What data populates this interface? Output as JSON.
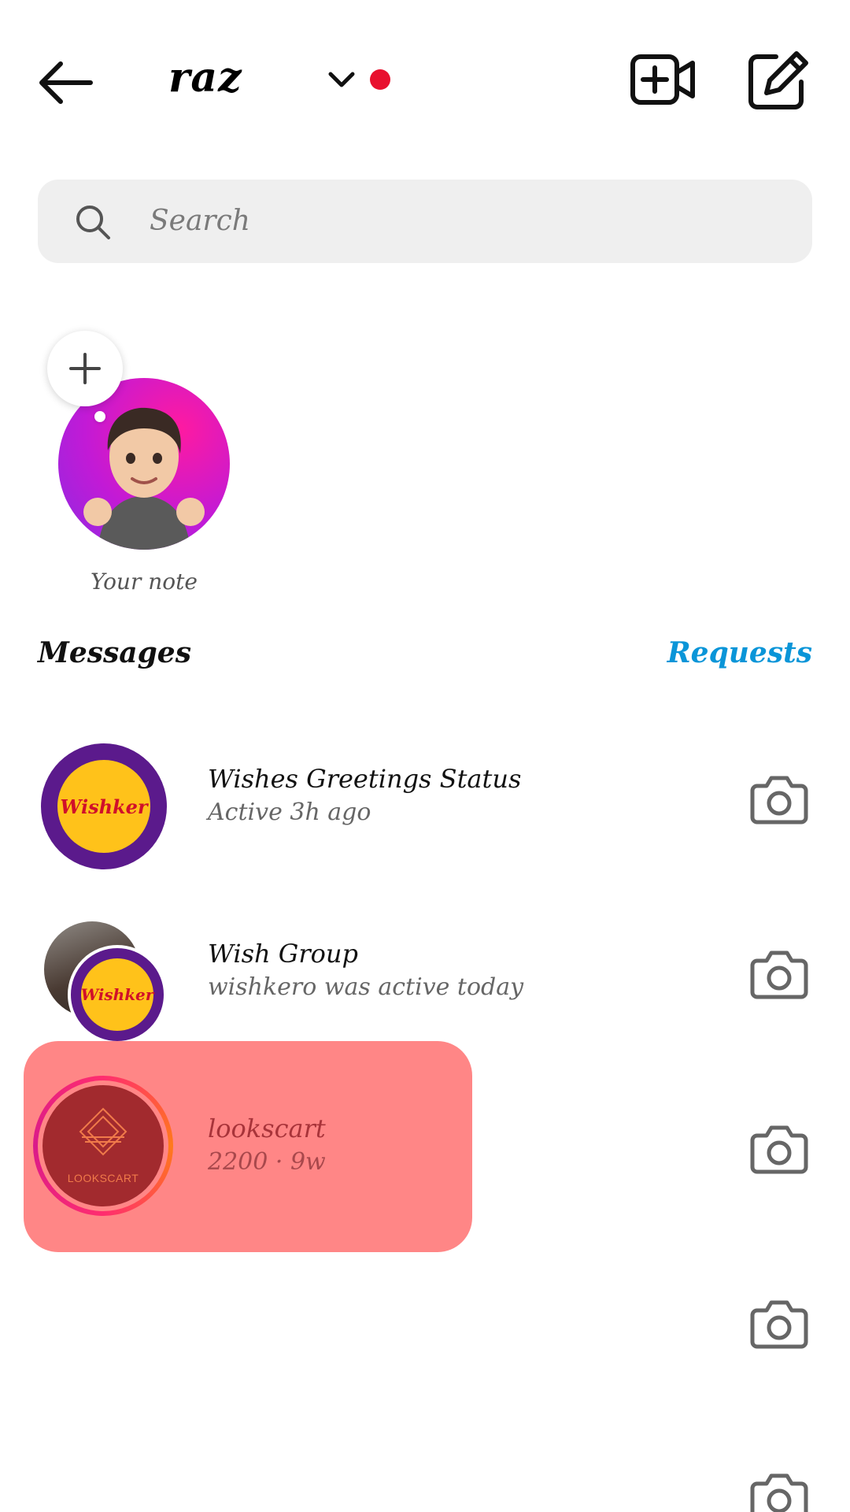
{
  "header": {
    "account_name": "raz",
    "notification_color": "#e8102e",
    "icons": [
      "back-arrow-icon",
      "chevron-down-icon",
      "new-video-call-icon",
      "compose-icon"
    ]
  },
  "search": {
    "placeholder": "Search"
  },
  "note": {
    "label": "Your note"
  },
  "messages": {
    "title": "Messages",
    "requests_label": "Requests",
    "requests_color": "#0a95d8"
  },
  "threads": [
    {
      "name": "Wishes Greetings Status",
      "status": "Active 3h ago",
      "avatar_text": "Wishker"
    },
    {
      "name": "Wish Group",
      "status": "wishkero was active today",
      "avatar_text": "Wishker"
    },
    {
      "name": "lookscart",
      "status": "2200 · 9w",
      "avatar_text": "LOOKSCART"
    }
  ]
}
